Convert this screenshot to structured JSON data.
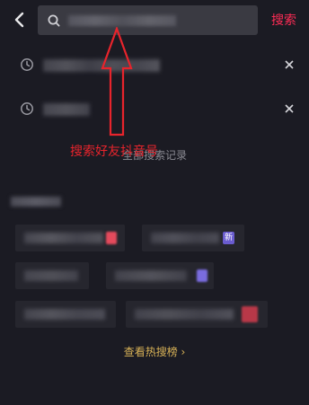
{
  "search": {
    "action_label": "搜索"
  },
  "history": {
    "items": [
      {
        "blurred": true
      },
      {
        "blurred": true
      }
    ],
    "all_history_label": "全部搜索记录"
  },
  "annotation": {
    "text": "搜索好友抖音号"
  },
  "trending": {
    "new_badge": "新",
    "more_label": "查看热搜榜 ›"
  },
  "colors": {
    "background": "#1b1b23",
    "search_box": "#3a3a42",
    "accent_red": "#fe2c55",
    "annotation_red": "#e8242c",
    "gold": "#d8b257",
    "badge_purple": "#6a5ccf"
  },
  "icons": {
    "back": "chevron-left-icon",
    "search": "search-icon",
    "history": "clock-icon",
    "close": "close-icon"
  }
}
